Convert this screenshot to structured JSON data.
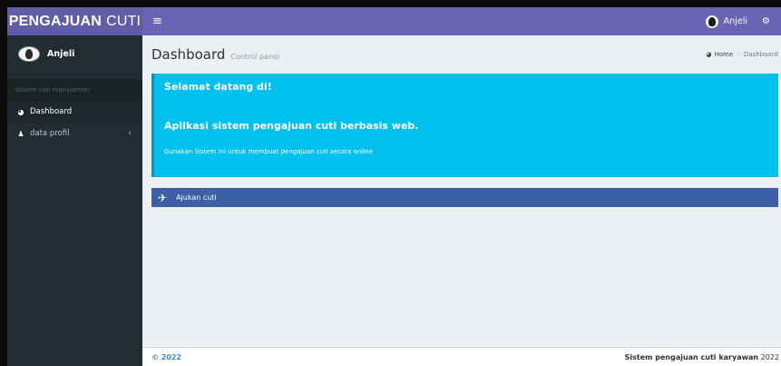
{
  "header": {
    "logo_bold": "PENGAJUAN",
    "logo_light": "CUTI",
    "toggle_icon": "≡",
    "user_name": "Anjeli"
  },
  "sidebar": {
    "user_name": "Anjeli",
    "section_header": "sistem cuti manajemen",
    "items": [
      {
        "label": "Dashboard",
        "icon": "dashboard-icon",
        "active": true
      },
      {
        "label": "data profil",
        "icon": "user-icon",
        "active": false
      }
    ]
  },
  "content": {
    "title": "Dashboard",
    "subtitle": "Control panel",
    "breadcrumb": {
      "home": "Home",
      "current": "Dashboard"
    },
    "callout": {
      "title": "Selamat datang di!",
      "heading": "Aplikasi sistem pengajuan cuti berbasis web.",
      "text": "Gunakan Sistem ini untuk membuat pengajuan cuti secara online"
    },
    "ajukan_label": "Ajukan cuti"
  },
  "footer": {
    "copyright": "© 2022",
    "right_bold": "Sistem pengajuan cuti karyawan",
    "right_year": "2022"
  },
  "colors": {
    "logo_bg": "#605ca8",
    "navbar_bg": "#6b63b5",
    "sidebar_bg": "#222d32",
    "callout_bg": "#00c0ef",
    "ajukan_bg": "#3c5fa6",
    "content_bg": "#ecf0f5"
  }
}
